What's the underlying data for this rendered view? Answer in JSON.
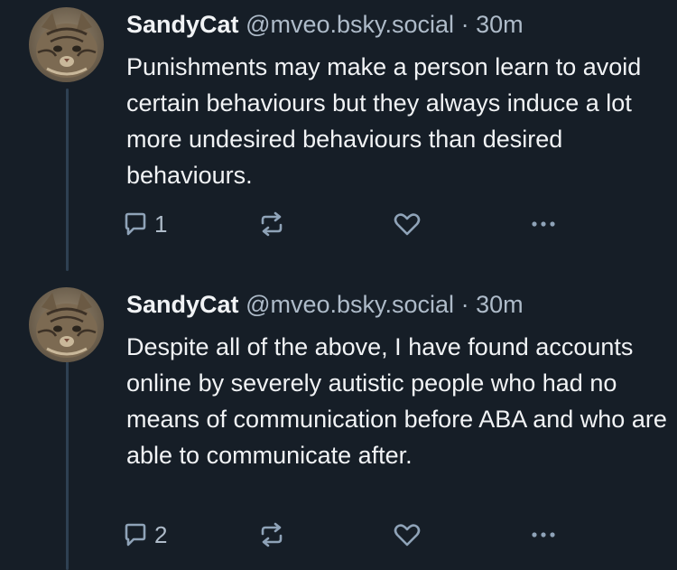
{
  "colors": {
    "background": "#161e27",
    "text": "#f1f3f5",
    "muted": "#aebbc9",
    "icon": "#8fa3b8",
    "thread_line": "#2e4052"
  },
  "posts": [
    {
      "author": {
        "display_name": "SandyCat",
        "handle": "@mveo.bsky.social",
        "avatar_icon": "tabby-cat-avatar"
      },
      "separator": "·",
      "time": "30m",
      "text": "Punishments may make a person learn to avoid certain behaviours but they always induce a lot more undesired behaviours than desired behaviours.",
      "reply_count": "1",
      "icons": [
        "reply-icon",
        "repost-icon",
        "like-icon",
        "more-icon"
      ]
    },
    {
      "author": {
        "display_name": "SandyCat",
        "handle": "@mveo.bsky.social",
        "avatar_icon": "tabby-cat-avatar"
      },
      "separator": "·",
      "time": "30m",
      "text": "Despite all of the above, I have found accounts online by severely autistic people who had no means of communication before ABA and who are able to communicate after.",
      "reply_count": "2",
      "icons": [
        "reply-icon",
        "repost-icon",
        "like-icon",
        "more-icon"
      ]
    }
  ]
}
